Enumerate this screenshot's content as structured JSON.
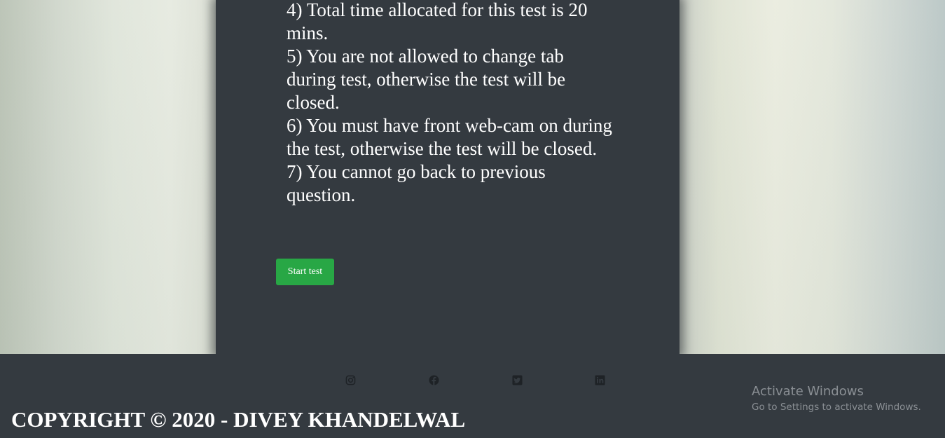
{
  "rules": [
    "4) Total time allocated for this test is 20 mins.",
    "5) You are not allowed to change tab during test, otherwise the test will be closed.",
    "6) You must have front web-cam on during the test, otherwise the test will be closed.",
    "7) You cannot go back to previous question."
  ],
  "start_button": {
    "label": "Start test"
  },
  "footer": {
    "social_icons": [
      "instagram-icon",
      "facebook-icon",
      "twitter-icon",
      "linkedin-icon"
    ],
    "copyright": "COPYRIGHT © 2020 - DIVEY KHANDELWAL"
  },
  "windows_watermark": {
    "title": "Activate Windows",
    "subtitle": "Go to Settings to activate Windows."
  },
  "colors": {
    "card_bg": "#343a40",
    "button_bg": "#28a745",
    "text": "#ffffff",
    "icon": "#1e2226"
  }
}
